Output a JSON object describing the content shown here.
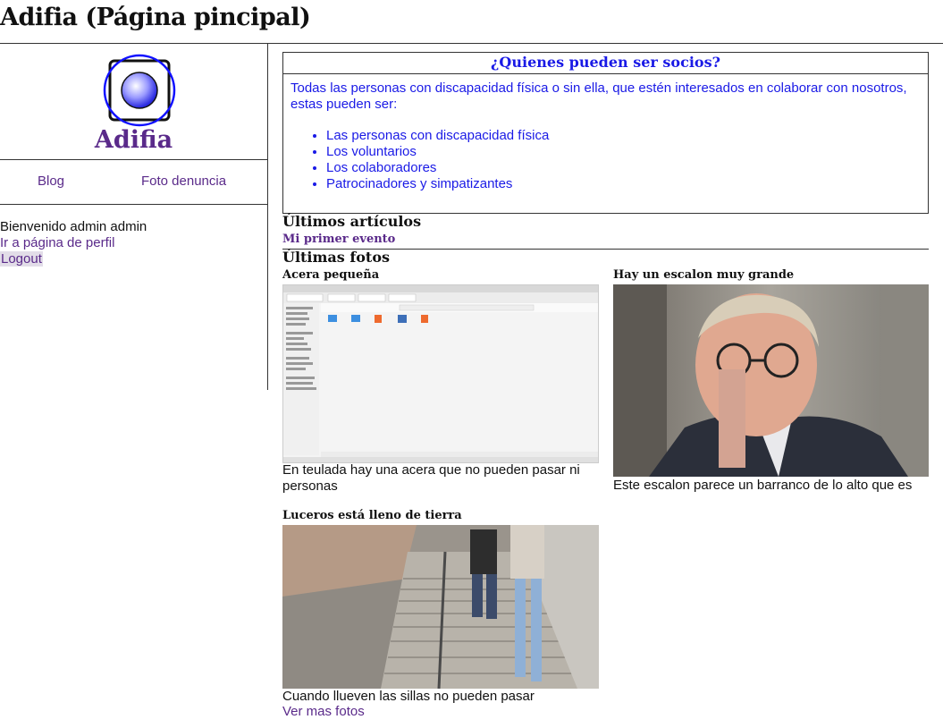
{
  "header": {
    "title": "Adifia (Página pincipal)"
  },
  "sidebar": {
    "brand": "Adifia",
    "nav": [
      {
        "label": "Blog"
      },
      {
        "label": "Foto denuncia"
      }
    ],
    "welcome": "Bienvenido admin admin",
    "profile_link": "Ir a página de perfil",
    "logout": "Logout"
  },
  "socios": {
    "heading": "¿Quienes pueden ser socios?",
    "intro": "Todas las personas con discapacidad física o sin ella, que estén interesados en colaborar con nosotros, estas pueden ser:",
    "items": [
      "Las personas con discapacidad física",
      "Los voluntarios",
      "Los colaboradores",
      "Patrocinadores y simpatizantes"
    ]
  },
  "articles": {
    "heading": "Últimos artículos",
    "items": [
      {
        "title": "Mi primer evento"
      }
    ]
  },
  "photos": {
    "heading": "Últimas fotos",
    "items": [
      {
        "title": "Acera pequeña",
        "caption": "En teulada hay una acera que no pueden pasar ni personas"
      },
      {
        "title": "Hay un escalon muy grande",
        "caption": "Este escalon parece un barranco de lo alto que es"
      },
      {
        "title": "Luceros está lleno de tierra",
        "caption": "Cuando llueven las sillas no pueden pasar"
      }
    ],
    "more_link": "Ver mas fotos"
  },
  "colors": {
    "link": "#5a2a8a",
    "accent_blue": "#1a1ae6"
  }
}
